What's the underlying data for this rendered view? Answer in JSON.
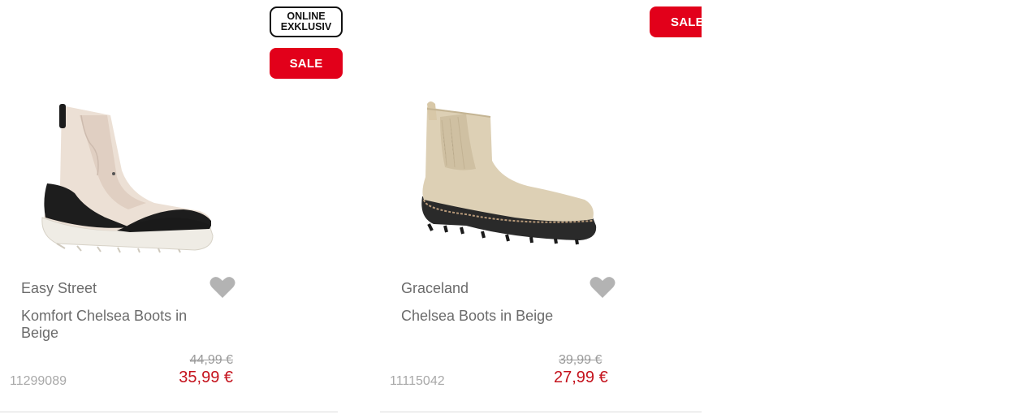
{
  "products": [
    {
      "badges": {
        "online_line1": "ONLINE",
        "online_line2": "EXKLUSIV",
        "sale": "SALE"
      },
      "brand": "Easy Street",
      "name": "Komfort Chelsea Boots in Beige",
      "old_price": "44,99 €",
      "new_price": "35,99 €",
      "sku": "11299089",
      "image": "beige-black-comfort-chelsea-boot",
      "wishlist_icon": "heart-icon"
    },
    {
      "badges": {
        "sale": "SALE"
      },
      "brand": "Graceland",
      "name": "Chelsea Boots in Beige",
      "old_price": "39,99 €",
      "new_price": "27,99 €",
      "sku": "11115042",
      "image": "beige-suede-chelsea-boot",
      "wishlist_icon": "heart-icon"
    }
  ],
  "colors": {
    "sale_red": "#e2001a",
    "price_red": "#c4121c",
    "text_gray": "#6b6b6b",
    "heart_gray": "#b3b3b3"
  }
}
